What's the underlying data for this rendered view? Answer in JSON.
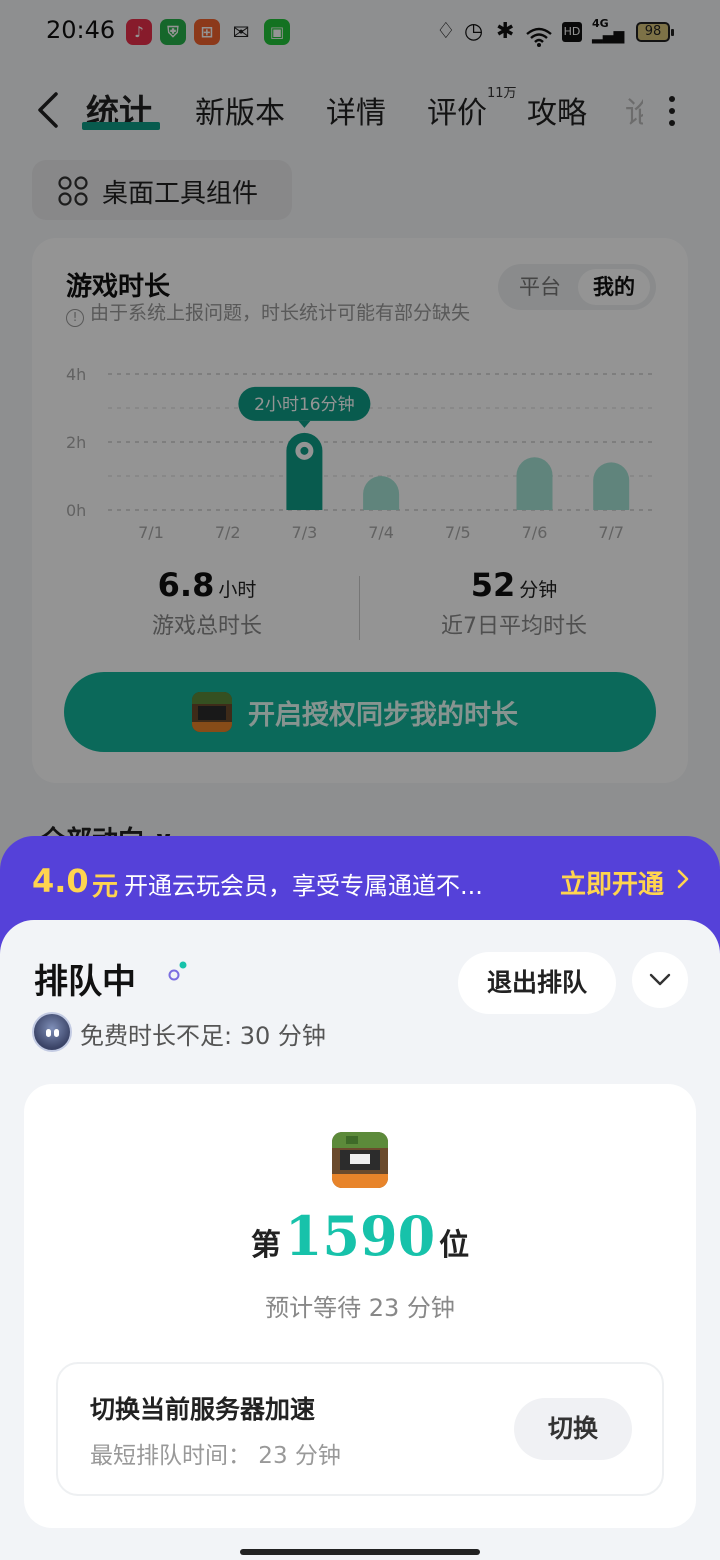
{
  "status_bar": {
    "time": "20:46",
    "app_icons": [
      "music-icon",
      "shield-icon",
      "app-icon",
      "wechat-icon",
      "wallet-icon"
    ],
    "system_icons": [
      "drop-icon",
      "alarm-icon",
      "bluetooth-icon",
      "wifi-icon",
      "hd-icon",
      "signal-icon"
    ],
    "hd_label": "HD",
    "network_label": "4G",
    "battery": "98"
  },
  "nav": {
    "tabs": [
      {
        "label": "统计",
        "active": true
      },
      {
        "label": "新版本"
      },
      {
        "label": "详情"
      },
      {
        "label": "评价"
      },
      {
        "label": "攻略"
      },
      {
        "label": "论"
      }
    ],
    "review_count": "11万"
  },
  "widget_button": {
    "label": "桌面工具组件"
  },
  "playtime_card": {
    "title": "游戏时长",
    "note": "由于系统上报问题，时长统计可能有部分缺失",
    "segments": [
      "平台",
      "我的"
    ],
    "active_segment": "我的",
    "total": {
      "value": "6.8",
      "unit": "小时",
      "label": "游戏总时长"
    },
    "average": {
      "value": "52",
      "unit": "分钟",
      "label": "近7日平均时长"
    },
    "auth_button": "开启授权同步我的时长"
  },
  "chart_data": {
    "type": "bar",
    "categories": [
      "7/1",
      "7/2",
      "7/3",
      "7/4",
      "7/5",
      "7/6",
      "7/7"
    ],
    "values": [
      0,
      0,
      2.27,
      1.0,
      0,
      1.55,
      1.4
    ],
    "yticks": [
      "4h",
      "2h",
      "0h"
    ],
    "ylim": [
      0,
      4
    ],
    "highlight_index": 2,
    "highlight_label": "2小时16分钟",
    "grid": true
  },
  "section_peek": "全部动向 ∨",
  "promo": {
    "price": "4.0",
    "unit": "元",
    "text": "开通云玩会员，享受专属通道不...",
    "cta": "立即开通"
  },
  "queue": {
    "title": "排队中",
    "quit_label": "退出排队",
    "free_time": "免费时长不足: 30 分钟",
    "rank_prefix": "第",
    "rank": "1590",
    "rank_suffix": "位",
    "wait": "预计等待 23 分钟",
    "server_title": "切换当前服务器加速",
    "server_sub": "最短排队时间： 23 分钟",
    "switch_label": "切换"
  },
  "colors": {
    "accent": "#13b59b",
    "promo_bg": "#5541d9",
    "promo_highlight": "#ffd44f",
    "rank": "#17c2aa"
  }
}
